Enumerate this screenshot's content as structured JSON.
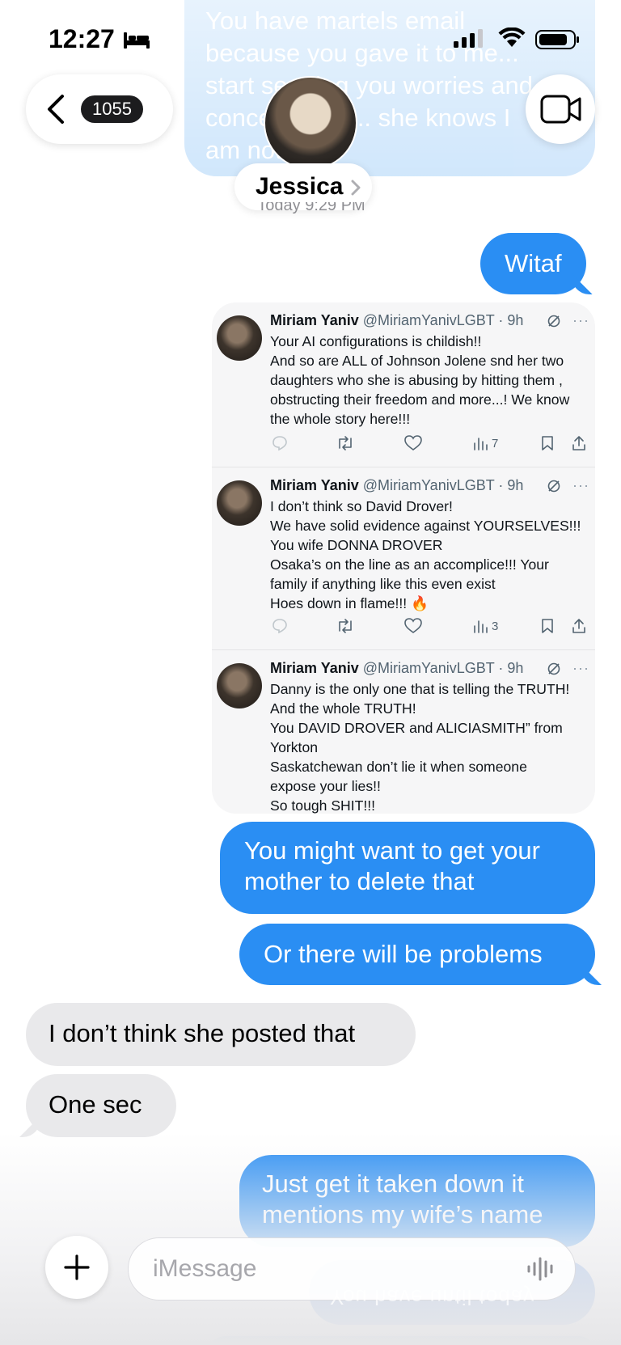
{
  "status_bar": {
    "time": "12:27",
    "icons": [
      "bed-icon",
      "cellular-signal-icon",
      "wifi-icon",
      "battery-icon"
    ]
  },
  "header": {
    "back_badge": "1055",
    "contact_name": "Jessica",
    "date_stamp": "Today 9:29 PM",
    "icons": [
      "back-chevron-icon",
      "video-camera-icon",
      "chevron-right-icon"
    ]
  },
  "messages": {
    "top_partial": [
      "You have martels email",
      "because you gave it to me...",
      "start sending you worries and",
      "concerns her .. she knows I",
      "am not"
    ],
    "witaf": "Witaf",
    "delete": [
      "You might want to get your",
      "mother to delete that"
    ],
    "problems": "Or there will be problems",
    "dont_think": "I don’t think she posted that",
    "one_sec": "One sec",
    "taken_down": [
      "Just get it taken down it",
      "mentions my wife’s name"
    ],
    "mirrored": "You have until today"
  },
  "tweets": [
    {
      "name": "Miriam Yaniv",
      "meta": "@MiriamYanivLGBT · 9h",
      "lines": [
        "Your AI configurations is childish!!",
        "And so are ALL of Johnson Jolene snd her two",
        "daughters who she is abusing by hitting them ,",
        "obstructing their freedom and more...! We know",
        "the whole story here!!!"
      ],
      "views": "7"
    },
    {
      "name": "Miriam Yaniv",
      "meta": "@MiriamYanivLGBT · 9h",
      "lines": [
        "I don’t think so David Drover!",
        "We have solid evidence against YOURSELVES!!!",
        "You wife DONNA DROVER",
        "Osaka’s on the line as an accomplice!!! Your",
        "family if anything like this even exist",
        "Hoes down in flame!!! 🔥"
      ],
      "views": "3"
    },
    {
      "name": "Miriam Yaniv",
      "meta": "@MiriamYanivLGBT · 9h",
      "lines": [
        "Danny is the only one that is telling the TRUTH!",
        "And the whole TRUTH!",
        "You DAVID DROVER and ALICIASMITH” from",
        "Yorkton",
        "Saskatchewan don’t lie it when someone",
        "expose your lies!!",
        "So tough SHIT!!!"
      ],
      "views": ""
    }
  ],
  "input": {
    "placeholder": "iMessage"
  },
  "colors": {
    "sent_bubble": "#2a8ef3",
    "received_bubble": "#e9e9eb",
    "faded_bubble": "#c9e3fb"
  }
}
